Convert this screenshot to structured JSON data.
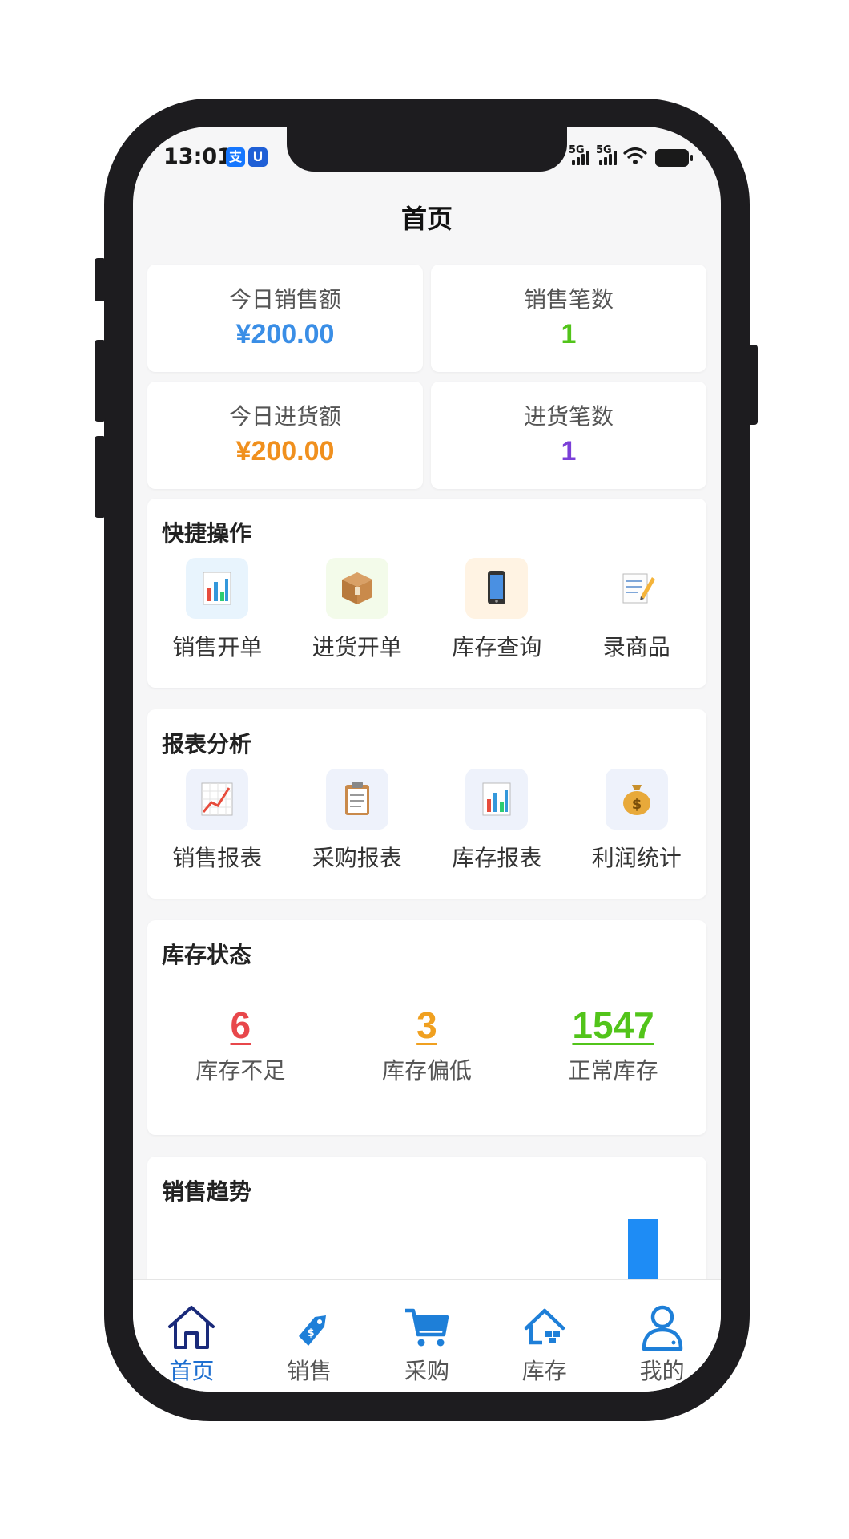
{
  "status_bar": {
    "time": "13:01",
    "signal_1": "5G",
    "signal_2": "5G"
  },
  "nav": {
    "title": "首页"
  },
  "stats": [
    {
      "label": "今日销售额",
      "value": "¥200.00",
      "color": "#3a8ee6"
    },
    {
      "label": "销售笔数",
      "value": "1",
      "color": "#52c41a"
    },
    {
      "label": "今日进货额",
      "value": "¥200.00",
      "color": "#f0901e"
    },
    {
      "label": "进货笔数",
      "value": "1",
      "color": "#7b3fd8"
    }
  ],
  "quick_ops": {
    "title": "快捷操作",
    "items": [
      {
        "label": "销售开单",
        "icon": "bar-chart-icon",
        "bg": "#e8f4fd"
      },
      {
        "label": "进货开单",
        "icon": "package-icon",
        "bg": "#f3fbea"
      },
      {
        "label": "库存查询",
        "icon": "mobile-phone-icon",
        "bg": "#fff3e3"
      },
      {
        "label": "录商品",
        "icon": "memo-icon",
        "bg": "#ffffff"
      }
    ]
  },
  "reports": {
    "title": "报表分析",
    "items": [
      {
        "label": "销售报表",
        "icon": "trend-up-icon",
        "bg": "#eef2fb"
      },
      {
        "label": "采购报表",
        "icon": "clipboard-icon",
        "bg": "#eef2fb"
      },
      {
        "label": "库存报表",
        "icon": "bar-chart-icon",
        "bg": "#eef2fb"
      },
      {
        "label": "利润统计",
        "icon": "money-bag-icon",
        "bg": "#eef2fb"
      }
    ]
  },
  "inventory": {
    "title": "库存状态",
    "items": [
      {
        "value": "6",
        "label": "库存不足",
        "color": "#e8474b"
      },
      {
        "value": "3",
        "label": "库存偏低",
        "color": "#f0a020"
      },
      {
        "value": "1547",
        "label": "正常库存",
        "color": "#52c41a"
      }
    ]
  },
  "trend": {
    "title": "销售趋势",
    "bar_color": "#1e8cf5"
  },
  "tabbar": {
    "items": [
      {
        "label": "首页",
        "icon": "home-icon",
        "active": true
      },
      {
        "label": "销售",
        "icon": "price-tag-icon",
        "active": false
      },
      {
        "label": "采购",
        "icon": "shopping-cart-icon",
        "active": false
      },
      {
        "label": "库存",
        "icon": "warehouse-icon",
        "active": false
      },
      {
        "label": "我的",
        "icon": "user-icon",
        "active": false
      }
    ],
    "active_color": "#1d6fd0",
    "inactive_color": "#555555"
  }
}
